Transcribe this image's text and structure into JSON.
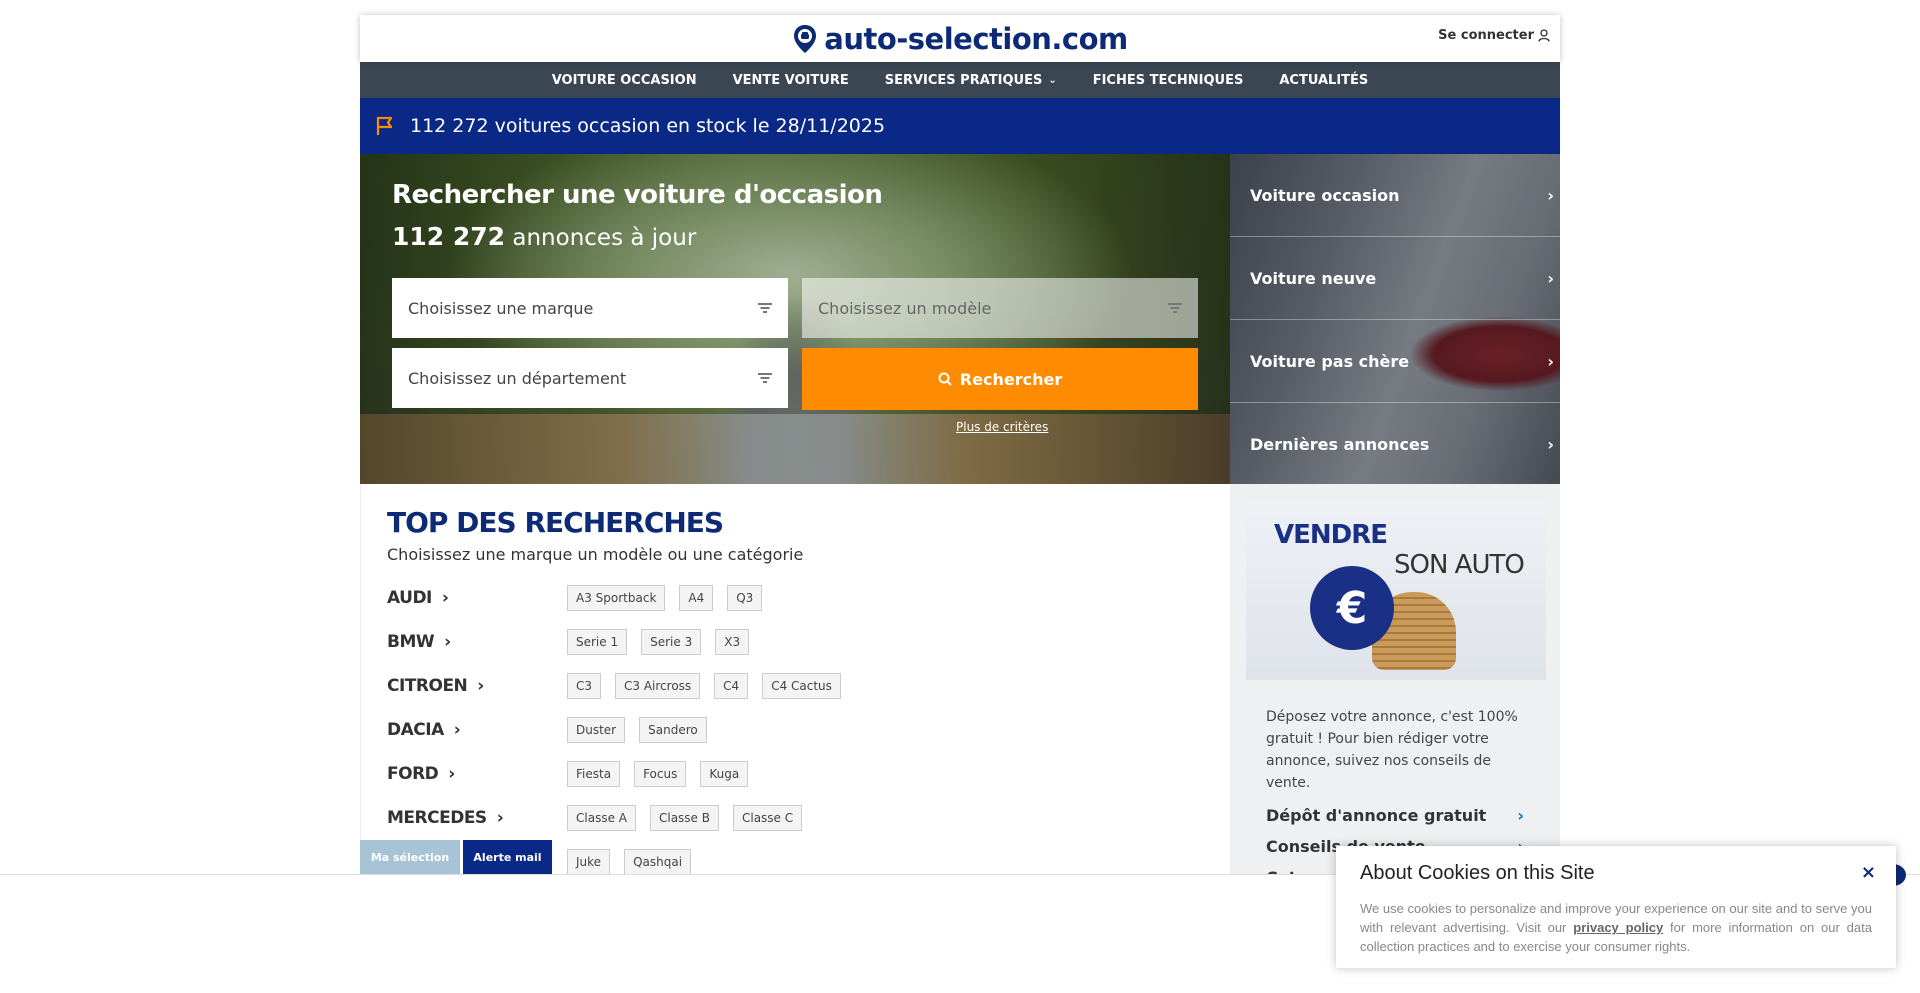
{
  "header": {
    "logo_text": "auto-selection.com",
    "login_label": "Se connecter"
  },
  "nav": {
    "items": [
      {
        "label": "VOITURE OCCASION"
      },
      {
        "label": "VENTE VOITURE"
      },
      {
        "label": "SERVICES PRATIQUES",
        "has_dropdown": true
      },
      {
        "label": "FICHES TECHNIQUES"
      },
      {
        "label": "ACTUALITÉS"
      }
    ]
  },
  "stock_bar": {
    "text": "112 272 voitures occasion en stock le 28/11/2025"
  },
  "hero": {
    "title": "Rechercher une voiture d'occasion",
    "count": "112 272",
    "count_suffix": " annonces à jour",
    "brand_placeholder": "Choisissez une marque",
    "model_placeholder": "Choisissez un modèle",
    "department_placeholder": "Choisissez un département",
    "search_label": "Rechercher",
    "more_criteria": "Plus de critères"
  },
  "side_links": [
    {
      "label": "Voiture occasion"
    },
    {
      "label": "Voiture neuve"
    },
    {
      "label": "Voiture pas chère"
    },
    {
      "label": "Dernières annonces"
    }
  ],
  "top_search": {
    "title": "TOP DES RECHERCHES",
    "subtitle": "Choisissez une marque un modèle ou une catégorie",
    "brands": [
      {
        "name": "AUDI",
        "models": [
          "A3 Sportback",
          "A4",
          "Q3"
        ]
      },
      {
        "name": "BMW",
        "models": [
          "Serie 1",
          "Serie 3",
          "X3"
        ]
      },
      {
        "name": "CITROEN",
        "models": [
          "C3",
          "C3 Aircross",
          "C4",
          "C4 Cactus"
        ]
      },
      {
        "name": "DACIA",
        "models": [
          "Duster",
          "Sandero"
        ]
      },
      {
        "name": "FORD",
        "models": [
          "Fiesta",
          "Focus",
          "Kuga"
        ]
      },
      {
        "name": "MERCEDES",
        "models": [
          "Classe A",
          "Classe B",
          "Classe C"
        ]
      },
      {
        "name": "",
        "models": [
          "Juke",
          "Qashqai"
        ]
      }
    ]
  },
  "sell_panel": {
    "img_title1": "VENDRE",
    "img_title2": "SON AUTO",
    "description": "Déposez votre annonce, c'est 100% gratuit ! Pour bien rédiger votre annonce, suivez nos conseils de vente.",
    "links": [
      {
        "label": "Dépôt d'annonce gratuit"
      },
      {
        "label": "Conseils de vente"
      },
      {
        "label": "Cote aut"
      }
    ]
  },
  "bottom_pills": {
    "selection": "Ma sélection",
    "mail_alert": "Alerte mail"
  },
  "cookie": {
    "title": "About Cookies on this Site",
    "close": "×",
    "text_before": "We use cookies to personalize and improve your experience on our site and to serve you with relevant advertising. Visit our ",
    "link_text": "privacy policy",
    "text_after": " for more information on our data collection practices and to exercise your consumer rights."
  },
  "colors": {
    "brand_blue": "#0a2885",
    "nav_bg": "#3b4653",
    "accent_orange": "#ff8c00"
  }
}
